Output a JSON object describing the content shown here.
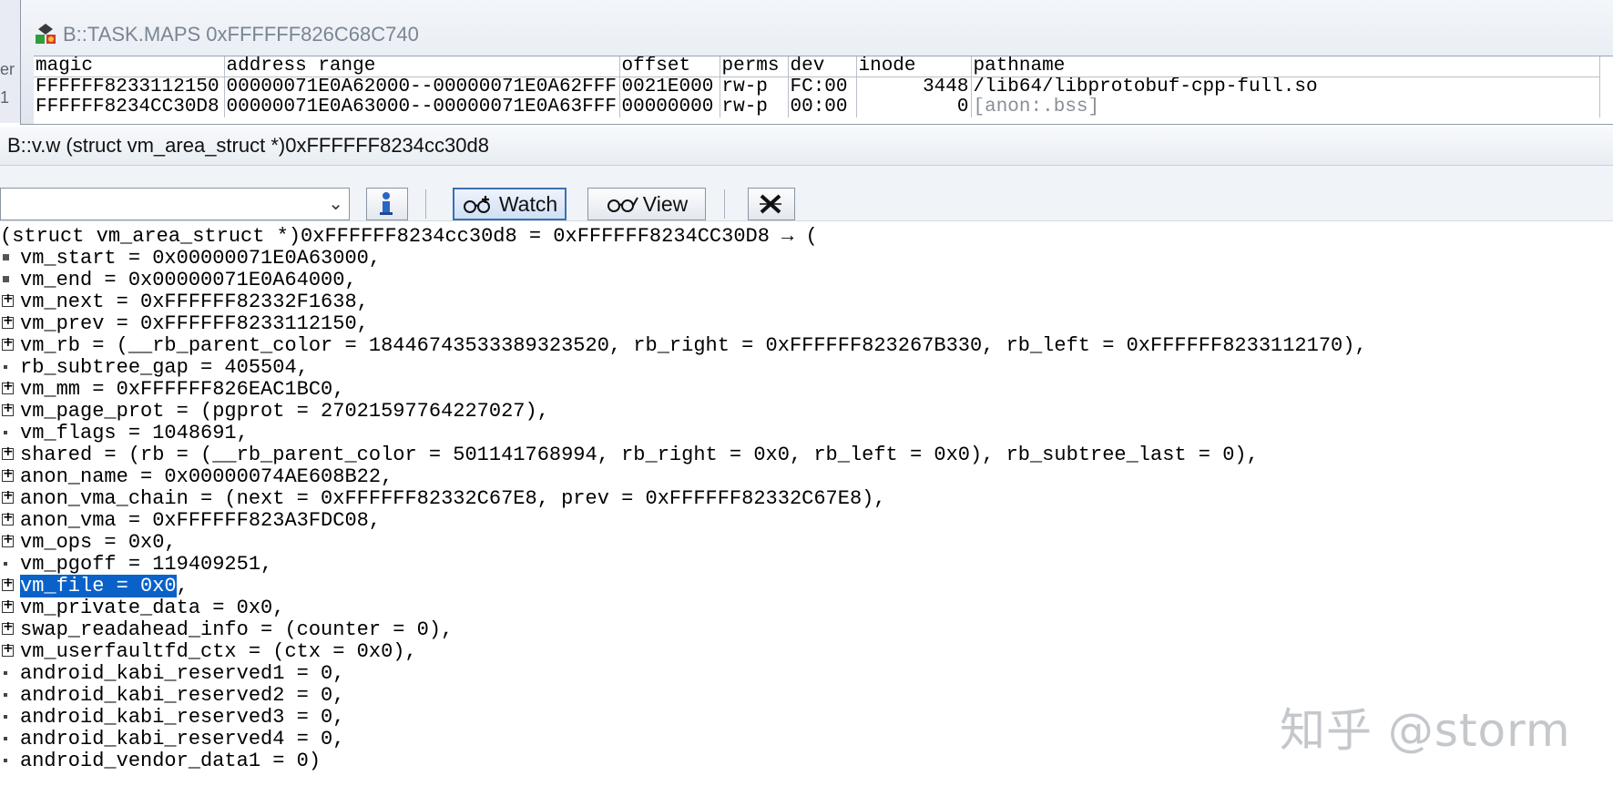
{
  "bg_window": {
    "fragments": [
      "er",
      "1"
    ]
  },
  "maps_window": {
    "title": "B::TASK.MAPS 0xFFFFFF826C68C740",
    "columns": [
      "magic",
      "address range",
      "offset",
      "perms",
      "dev",
      "inode",
      "pathname"
    ],
    "rows": [
      [
        "FFFFFF8233112150",
        "00000071E0A62000--00000071E0A62FFF",
        "0021E000",
        "rw-p",
        "FC:00",
        "3448",
        "/lib64/libprotobuf-cpp-full.so"
      ],
      [
        "FFFFFF8234CC30D8",
        "00000071E0A63000--00000071E0A63FFF",
        "00000000",
        "rw-p",
        "00:00",
        "0",
        "[anon:.bss]"
      ]
    ]
  },
  "vw_window": {
    "title": "B::v.w (struct vm_area_struct *)0xFFFFFF8234cc30d8",
    "toolbar": {
      "expression_value": "",
      "watch_label": "Watch",
      "view_label": "View"
    }
  },
  "dump": {
    "header": "(struct vm_area_struct *)0xFFFFFF8234cc30d8 = 0xFFFFFF8234CC30D8 → (",
    "lines": [
      {
        "marker": "square",
        "text": "vm_start = 0x00000071E0A63000,"
      },
      {
        "marker": "square",
        "text": "vm_end = 0x00000071E0A64000,"
      },
      {
        "marker": "expand",
        "text": "vm_next = 0xFFFFFF82332F1638,"
      },
      {
        "marker": "expand",
        "text": "vm_prev = 0xFFFFFF8233112150,"
      },
      {
        "marker": "expand",
        "text": "vm_rb = (__rb_parent_color = 18446743533389323520, rb_right = 0xFFFFFF823267B330, rb_left = 0xFFFFFF8233112170),"
      },
      {
        "marker": "dot",
        "text": "rb_subtree_gap = 405504,"
      },
      {
        "marker": "expand",
        "text": "vm_mm = 0xFFFFFF826EAC1BC0,"
      },
      {
        "marker": "expand",
        "text": "vm_page_prot = (pgprot = 27021597764227027),"
      },
      {
        "marker": "dot",
        "text": "vm_flags = 1048691,"
      },
      {
        "marker": "expand",
        "text": "shared = (rb = (__rb_parent_color = 501141768994, rb_right = 0x0, rb_left = 0x0), rb_subtree_last = 0),"
      },
      {
        "marker": "expand",
        "text": "anon_name = 0x00000074AE608B22,"
      },
      {
        "marker": "expand",
        "text": "anon_vma_chain = (next = 0xFFFFFF82332C67E8, prev = 0xFFFFFF82332C67E8),"
      },
      {
        "marker": "expand",
        "text": "anon_vma = 0xFFFFFF823A3FDC08,"
      },
      {
        "marker": "expand",
        "text": "vm_ops = 0x0,"
      },
      {
        "marker": "dot",
        "text": "vm_pgoff = 119409251,"
      },
      {
        "marker": "expand",
        "text": "vm_file = 0x0",
        "highlight": true,
        "suffix": ","
      },
      {
        "marker": "expand",
        "text": "vm_private_data = 0x0,"
      },
      {
        "marker": "expand",
        "text": "swap_readahead_info = (counter = 0),"
      },
      {
        "marker": "expand",
        "text": "vm_userfaultfd_ctx = (ctx = 0x0),"
      },
      {
        "marker": "dot",
        "text": "android_kabi_reserved1 = 0,"
      },
      {
        "marker": "dot",
        "text": "android_kabi_reserved2 = 0,"
      },
      {
        "marker": "dot",
        "text": "android_kabi_reserved3 = 0,"
      },
      {
        "marker": "dot",
        "text": "android_kabi_reserved4 = 0,"
      },
      {
        "marker": "dot",
        "text": "android_vendor_data1 = 0)"
      }
    ]
  },
  "watermark": "知乎 @storm",
  "colors": {
    "selection": "#0a62c8",
    "title_gray": "#7b8593"
  }
}
